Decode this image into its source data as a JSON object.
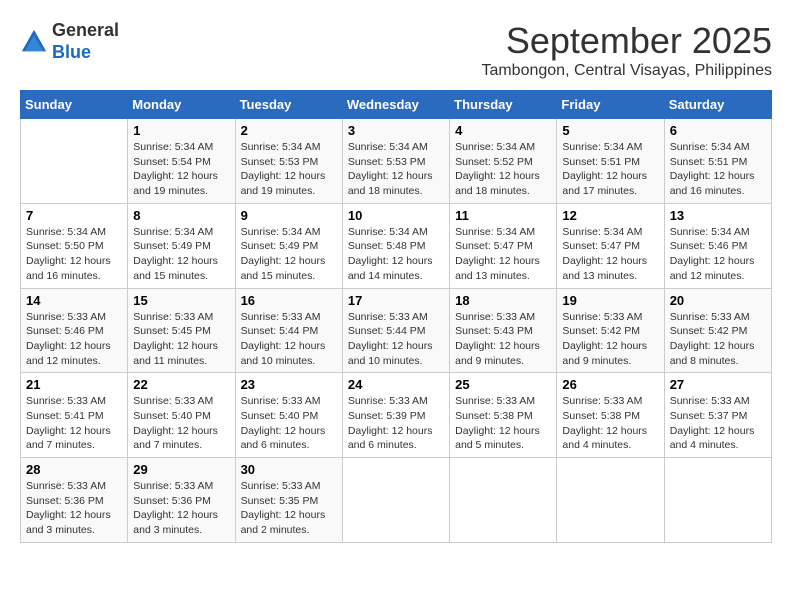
{
  "header": {
    "logo_general": "General",
    "logo_blue": "Blue",
    "month_title": "September 2025",
    "location": "Tambongon, Central Visayas, Philippines"
  },
  "weekdays": [
    "Sunday",
    "Monday",
    "Tuesday",
    "Wednesday",
    "Thursday",
    "Friday",
    "Saturday"
  ],
  "weeks": [
    [
      {
        "day": "",
        "info": ""
      },
      {
        "day": "1",
        "info": "Sunrise: 5:34 AM\nSunset: 5:54 PM\nDaylight: 12 hours\nand 19 minutes."
      },
      {
        "day": "2",
        "info": "Sunrise: 5:34 AM\nSunset: 5:53 PM\nDaylight: 12 hours\nand 19 minutes."
      },
      {
        "day": "3",
        "info": "Sunrise: 5:34 AM\nSunset: 5:53 PM\nDaylight: 12 hours\nand 18 minutes."
      },
      {
        "day": "4",
        "info": "Sunrise: 5:34 AM\nSunset: 5:52 PM\nDaylight: 12 hours\nand 18 minutes."
      },
      {
        "day": "5",
        "info": "Sunrise: 5:34 AM\nSunset: 5:51 PM\nDaylight: 12 hours\nand 17 minutes."
      },
      {
        "day": "6",
        "info": "Sunrise: 5:34 AM\nSunset: 5:51 PM\nDaylight: 12 hours\nand 16 minutes."
      }
    ],
    [
      {
        "day": "7",
        "info": "Sunrise: 5:34 AM\nSunset: 5:50 PM\nDaylight: 12 hours\nand 16 minutes."
      },
      {
        "day": "8",
        "info": "Sunrise: 5:34 AM\nSunset: 5:49 PM\nDaylight: 12 hours\nand 15 minutes."
      },
      {
        "day": "9",
        "info": "Sunrise: 5:34 AM\nSunset: 5:49 PM\nDaylight: 12 hours\nand 15 minutes."
      },
      {
        "day": "10",
        "info": "Sunrise: 5:34 AM\nSunset: 5:48 PM\nDaylight: 12 hours\nand 14 minutes."
      },
      {
        "day": "11",
        "info": "Sunrise: 5:34 AM\nSunset: 5:47 PM\nDaylight: 12 hours\nand 13 minutes."
      },
      {
        "day": "12",
        "info": "Sunrise: 5:34 AM\nSunset: 5:47 PM\nDaylight: 12 hours\nand 13 minutes."
      },
      {
        "day": "13",
        "info": "Sunrise: 5:34 AM\nSunset: 5:46 PM\nDaylight: 12 hours\nand 12 minutes."
      }
    ],
    [
      {
        "day": "14",
        "info": "Sunrise: 5:33 AM\nSunset: 5:46 PM\nDaylight: 12 hours\nand 12 minutes."
      },
      {
        "day": "15",
        "info": "Sunrise: 5:33 AM\nSunset: 5:45 PM\nDaylight: 12 hours\nand 11 minutes."
      },
      {
        "day": "16",
        "info": "Sunrise: 5:33 AM\nSunset: 5:44 PM\nDaylight: 12 hours\nand 10 minutes."
      },
      {
        "day": "17",
        "info": "Sunrise: 5:33 AM\nSunset: 5:44 PM\nDaylight: 12 hours\nand 10 minutes."
      },
      {
        "day": "18",
        "info": "Sunrise: 5:33 AM\nSunset: 5:43 PM\nDaylight: 12 hours\nand 9 minutes."
      },
      {
        "day": "19",
        "info": "Sunrise: 5:33 AM\nSunset: 5:42 PM\nDaylight: 12 hours\nand 9 minutes."
      },
      {
        "day": "20",
        "info": "Sunrise: 5:33 AM\nSunset: 5:42 PM\nDaylight: 12 hours\nand 8 minutes."
      }
    ],
    [
      {
        "day": "21",
        "info": "Sunrise: 5:33 AM\nSunset: 5:41 PM\nDaylight: 12 hours\nand 7 minutes."
      },
      {
        "day": "22",
        "info": "Sunrise: 5:33 AM\nSunset: 5:40 PM\nDaylight: 12 hours\nand 7 minutes."
      },
      {
        "day": "23",
        "info": "Sunrise: 5:33 AM\nSunset: 5:40 PM\nDaylight: 12 hours\nand 6 minutes."
      },
      {
        "day": "24",
        "info": "Sunrise: 5:33 AM\nSunset: 5:39 PM\nDaylight: 12 hours\nand 6 minutes."
      },
      {
        "day": "25",
        "info": "Sunrise: 5:33 AM\nSunset: 5:38 PM\nDaylight: 12 hours\nand 5 minutes."
      },
      {
        "day": "26",
        "info": "Sunrise: 5:33 AM\nSunset: 5:38 PM\nDaylight: 12 hours\nand 4 minutes."
      },
      {
        "day": "27",
        "info": "Sunrise: 5:33 AM\nSunset: 5:37 PM\nDaylight: 12 hours\nand 4 minutes."
      }
    ],
    [
      {
        "day": "28",
        "info": "Sunrise: 5:33 AM\nSunset: 5:36 PM\nDaylight: 12 hours\nand 3 minutes."
      },
      {
        "day": "29",
        "info": "Sunrise: 5:33 AM\nSunset: 5:36 PM\nDaylight: 12 hours\nand 3 minutes."
      },
      {
        "day": "30",
        "info": "Sunrise: 5:33 AM\nSunset: 5:35 PM\nDaylight: 12 hours\nand 2 minutes."
      },
      {
        "day": "",
        "info": ""
      },
      {
        "day": "",
        "info": ""
      },
      {
        "day": "",
        "info": ""
      },
      {
        "day": "",
        "info": ""
      }
    ]
  ]
}
